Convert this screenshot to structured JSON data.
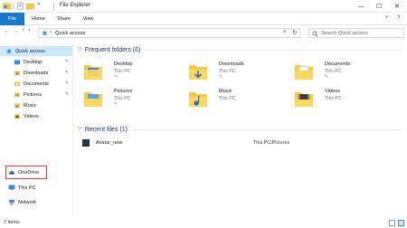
{
  "window": {
    "title": "File Explorer",
    "minimize": "—",
    "maximize": "☐",
    "close": "✕"
  },
  "ribbon": {
    "tabs": [
      "File",
      "Home",
      "Share",
      "View"
    ],
    "expand": "˅",
    "help": "?"
  },
  "address_bar": {
    "back": "←",
    "forward": "→",
    "recent": "˅",
    "up": "↑",
    "path_separator": "›",
    "location": "Quick access",
    "dropdown": "˅",
    "refresh": "↻",
    "search_placeholder": "Search Quick access"
  },
  "sidebar": {
    "items": [
      {
        "label": "Quick access",
        "icon": "star-icon",
        "pinned": false
      },
      {
        "label": "Desktop",
        "icon": "desktop-folder-icon",
        "pinned": true
      },
      {
        "label": "Downloads",
        "icon": "downloads-folder-icon",
        "pinned": true
      },
      {
        "label": "Documents",
        "icon": "documents-folder-icon",
        "pinned": true
      },
      {
        "label": "Pictures",
        "icon": "pictures-folder-icon",
        "pinned": true
      },
      {
        "label": "Music",
        "icon": "music-folder-icon",
        "pinned": false
      },
      {
        "label": "Videos",
        "icon": "videos-folder-icon",
        "pinned": false
      },
      {
        "label": "OneDrive",
        "icon": "onedrive-cloud-icon",
        "pinned": false
      },
      {
        "label": "This PC",
        "icon": "computer-icon",
        "pinned": false
      },
      {
        "label": "Network",
        "icon": "network-icon",
        "pinned": false
      }
    ],
    "pin_glyph": "📌"
  },
  "frequent": {
    "header": "Frequent folders (6)",
    "folders": [
      {
        "name": "Desktop",
        "location": "This PC"
      },
      {
        "name": "Downloads",
        "location": "This PC"
      },
      {
        "name": "Documents",
        "location": "This PC"
      },
      {
        "name": "Pictures",
        "location": "This PC"
      },
      {
        "name": "Music",
        "location": "This PC"
      },
      {
        "name": "Videos",
        "location": "This PC"
      }
    ],
    "pin_glyph": "✎"
  },
  "recent": {
    "header": "Recent files (1)",
    "files": [
      {
        "name": "Avatar_new",
        "path": "This PC\\Pictures"
      }
    ]
  },
  "status": {
    "text": "7 items"
  },
  "colors": {
    "accent": "#1979ca",
    "highlight_box": "#e43a2f",
    "folder_yellow": "#f7c94b",
    "section_header": "#1e3287"
  }
}
